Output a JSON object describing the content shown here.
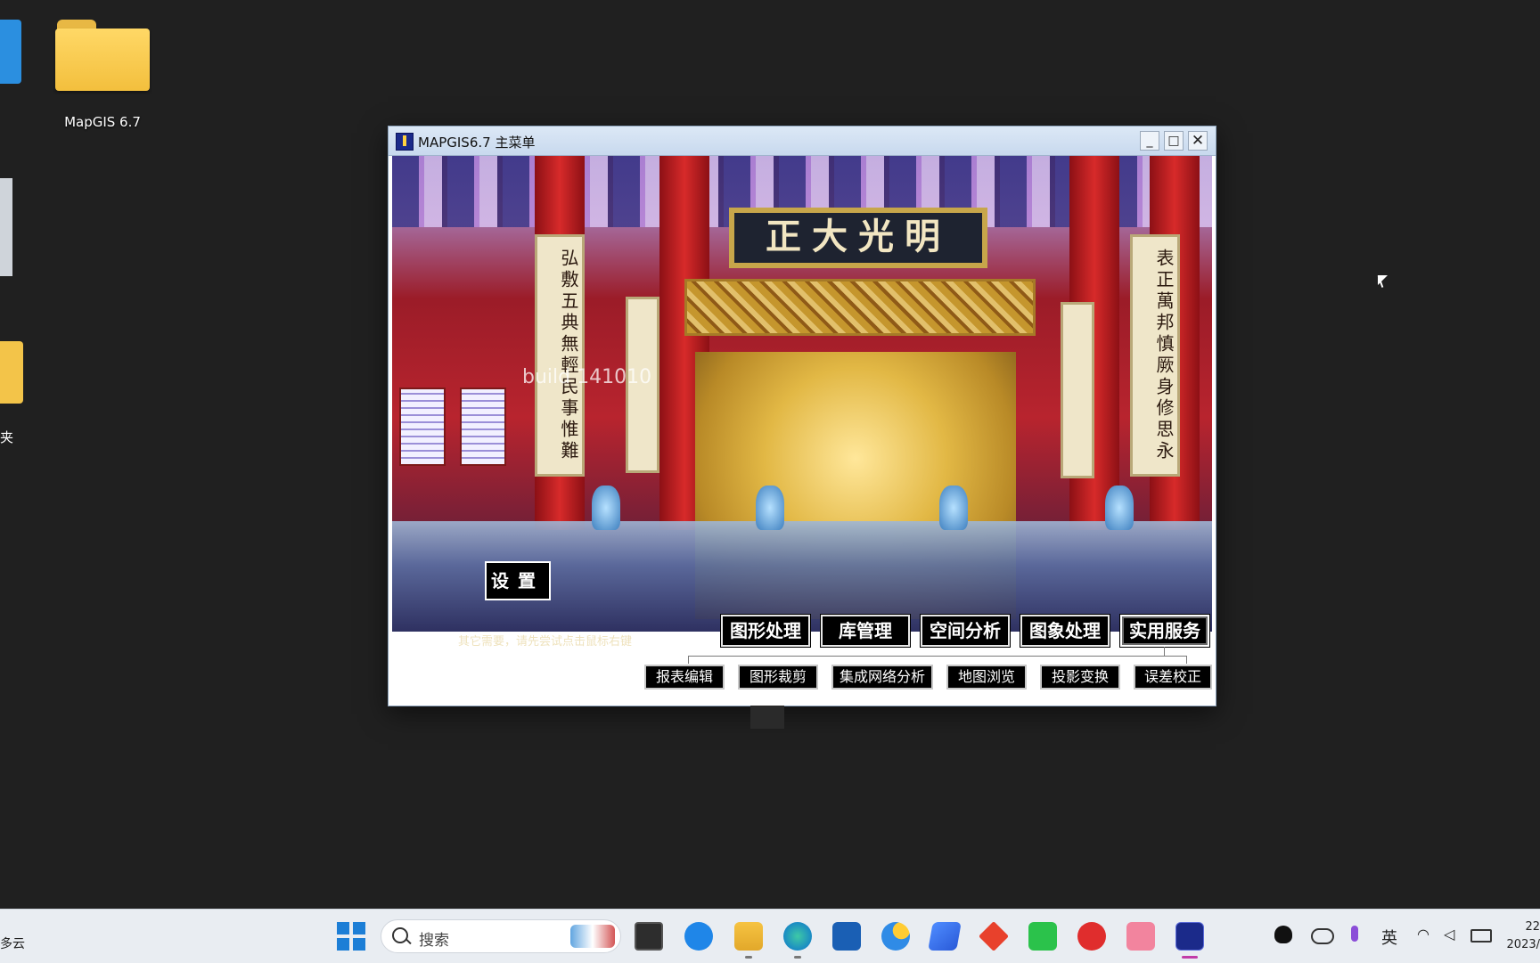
{
  "desktop": {
    "icons": [
      {
        "label": "MapGIS 6.7"
      },
      {
        "label": "夹"
      }
    ]
  },
  "window": {
    "title": "MAPGIS6.7 主菜单",
    "controls": {
      "minimize": "_",
      "maximize": "□",
      "close": "✕"
    },
    "plaque_text": "正大光明",
    "scroll_left": "弘敷五典無輕民事惟難",
    "scroll_right": "表正萬邦慎厥身修思永",
    "build_label": "build 141010",
    "settings_label": "设置",
    "hint": "其它需要，请先尝试点击鼠标右键",
    "main_menu": [
      {
        "label": "图形处理"
      },
      {
        "label": "库管理"
      },
      {
        "label": "空间分析"
      },
      {
        "label": "图象处理"
      },
      {
        "label": "实用服务"
      }
    ],
    "sub_menu": [
      {
        "label": "报表编辑"
      },
      {
        "label": "图形裁剪"
      },
      {
        "label": "集成网络分析"
      },
      {
        "label": "地图浏览"
      },
      {
        "label": "投影变换"
      },
      {
        "label": "误差校正"
      }
    ]
  },
  "taskbar": {
    "left_text": "多云",
    "search_placeholder": "搜索",
    "ime": "英",
    "clock_time": "22",
    "clock_date": "2023/"
  }
}
